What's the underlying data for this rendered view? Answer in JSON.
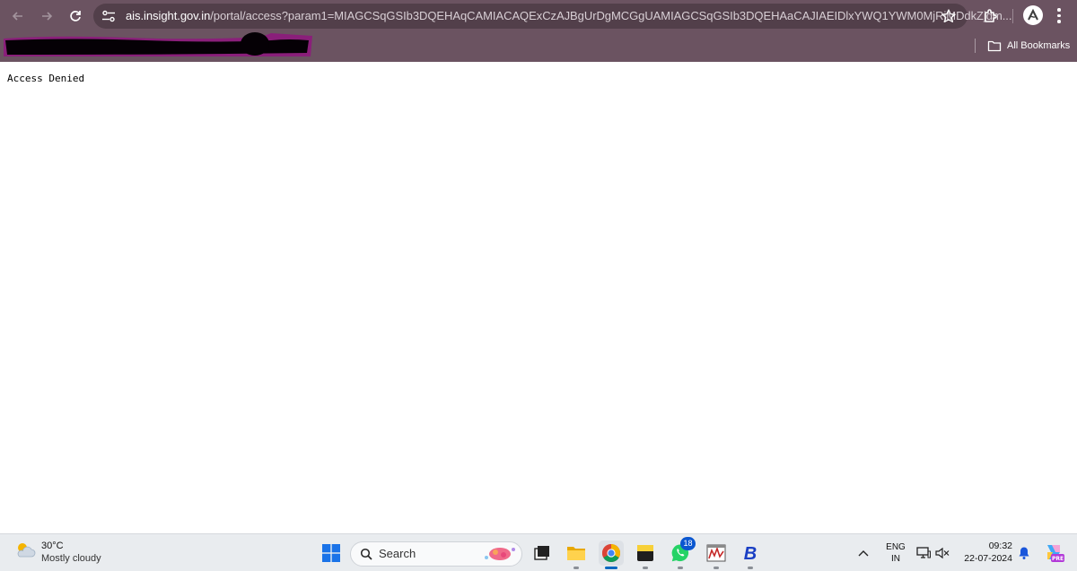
{
  "browser": {
    "url_host": "ais.insight.gov.in",
    "url_rest": "/portal/access?param1=MIAGCSqGSIb3DQEHAqCAMIACAQExCzAJBgUrDgMCGgUAMIAGCSqGSIb3DQEHAaCAJIAEIDlxYWQ1YWM0MjRjMDdkZjdm...",
    "all_bookmarks_label": "All Bookmarks",
    "accent": "#6b5361"
  },
  "page": {
    "message": "Access Denied"
  },
  "taskbar": {
    "weather_temp": "30°C",
    "weather_condition": "Mostly cloudy",
    "search_label": "Search",
    "whatsapp_badge": "18",
    "lang_line1": "ENG",
    "lang_line2": "IN",
    "time": "09:32",
    "date": "22-07-2024",
    "copilot_badge": "PRE"
  }
}
